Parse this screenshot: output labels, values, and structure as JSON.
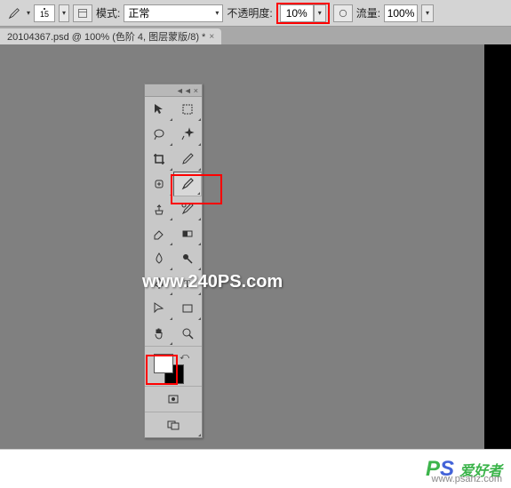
{
  "toolbar": {
    "brush_size": "15",
    "mode_label": "模式:",
    "mode_value": "正常",
    "opacity_label": "不透明度:",
    "opacity_value": "10%",
    "flow_label": "流量:",
    "flow_value": "100%"
  },
  "tab": {
    "title": "20104367.psd @ 100% (色阶 4, 图层蒙版/8) *",
    "close": "×"
  },
  "tools_panel": {
    "collapse": "◄◄",
    "close": "×"
  },
  "colors": {
    "foreground": "#ffffff",
    "background": "#000000"
  },
  "watermark": "www.240PS.com",
  "footer": {
    "logo_p": "P",
    "logo_s": "S",
    "text": "爱好者",
    "url": "www.psahz.com"
  }
}
